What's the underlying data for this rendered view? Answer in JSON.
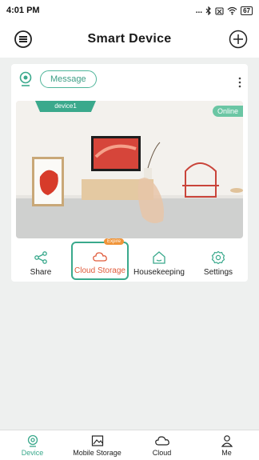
{
  "status_bar": {
    "time": "4:01 PM",
    "signal_dots": "...",
    "battery": "67"
  },
  "header": {
    "title": "Smart Device"
  },
  "device_card": {
    "message_button": "Message",
    "device_name": "device1",
    "status": "Online"
  },
  "actions": [
    {
      "label": "Share",
      "icon": "share-icon"
    },
    {
      "label": "Cloud Storage",
      "icon": "cloud-icon",
      "badge": "Expire"
    },
    {
      "label": "Housekeeping",
      "icon": "home-icon"
    },
    {
      "label": "Settings",
      "icon": "gear-icon"
    }
  ],
  "tabbar": [
    {
      "label": "Device",
      "icon": "camera-icon",
      "active": true
    },
    {
      "label": "Mobile Storage",
      "icon": "image-icon"
    },
    {
      "label": "Cloud",
      "icon": "cloud-icon"
    },
    {
      "label": "Me",
      "icon": "user-icon"
    }
  ],
  "colors": {
    "accent": "#3aa98c",
    "highlight": "#e05a3a",
    "expire": "#f0953a"
  }
}
